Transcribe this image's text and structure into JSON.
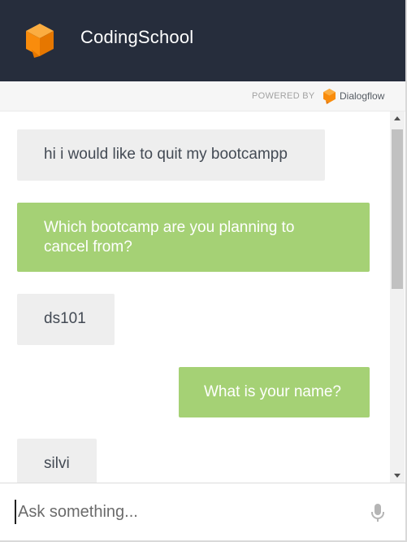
{
  "header": {
    "app_title": "CodingSchool",
    "logo_color": "#f98c0c",
    "background": "#262d3c"
  },
  "powered": {
    "label": "POWERED BY",
    "brand": "Dialogflow"
  },
  "messages": [
    {
      "sender": "user",
      "text": "hi i would like to quit my bootcampp"
    },
    {
      "sender": "agent",
      "text": "Which bootcamp are you planning to cancel from?"
    },
    {
      "sender": "user",
      "text": "ds101"
    },
    {
      "sender": "agent",
      "text": "What is your name?"
    },
    {
      "sender": "user",
      "text": "silvi"
    }
  ],
  "colors": {
    "agent_bubble": "#a5d175",
    "user_bubble": "#eeeeee"
  },
  "input": {
    "placeholder": "Ask something...",
    "value": ""
  },
  "icons": {
    "logo": "orange-cube-icon",
    "dialogflow": "dialogflow-logo-icon",
    "mic": "microphone-icon"
  }
}
